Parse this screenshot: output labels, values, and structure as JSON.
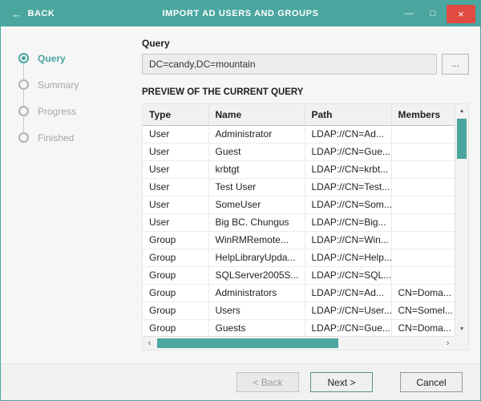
{
  "window": {
    "back_label": "BACK",
    "title": "IMPORT AD USERS AND GROUPS"
  },
  "icons": {
    "back_arrow": "←",
    "minimize": "—",
    "maximize": "□",
    "close": "×",
    "scroll_up": "▲",
    "scroll_down": "▼",
    "scroll_left": "‹",
    "scroll_right": "›"
  },
  "colors": {
    "accent": "#4aa69f",
    "close_red": "#e14a42"
  },
  "steps": [
    {
      "label": "Query",
      "active": true
    },
    {
      "label": "Summary",
      "active": false
    },
    {
      "label": "Progress",
      "active": false
    },
    {
      "label": "Finished",
      "active": false
    }
  ],
  "query": {
    "label": "Query",
    "value": "DC=candy,DC=mountain",
    "browse_label": "..."
  },
  "preview": {
    "title": "PREVIEW OF THE CURRENT QUERY",
    "columns": [
      "Type",
      "Name",
      "Path",
      "Members"
    ],
    "rows": [
      {
        "type": "User",
        "name": "Administrator",
        "path": "LDAP://CN=Ad...",
        "members": ""
      },
      {
        "type": "User",
        "name": "Guest",
        "path": "LDAP://CN=Gue...",
        "members": ""
      },
      {
        "type": "User",
        "name": "krbtgt",
        "path": "LDAP://CN=krbt...",
        "members": ""
      },
      {
        "type": "User",
        "name": "Test User",
        "path": "LDAP://CN=Test...",
        "members": ""
      },
      {
        "type": "User",
        "name": "SomeUser",
        "path": "LDAP://CN=Som...",
        "members": ""
      },
      {
        "type": "User",
        "name": "Big BC. Chungus",
        "path": "LDAP://CN=Big...",
        "members": ""
      },
      {
        "type": "Group",
        "name": "WinRMRemote...",
        "path": "LDAP://CN=Win...",
        "members": ""
      },
      {
        "type": "Group",
        "name": "HelpLibraryUpda...",
        "path": "LDAP://CN=Help...",
        "members": ""
      },
      {
        "type": "Group",
        "name": "SQLServer2005S...",
        "path": "LDAP://CN=SQL...",
        "members": ""
      },
      {
        "type": "Group",
        "name": "Administrators",
        "path": "LDAP://CN=Ad...",
        "members": "CN=Doma..."
      },
      {
        "type": "Group",
        "name": "Users",
        "path": "LDAP://CN=User...",
        "members": "CN=Somel..."
      },
      {
        "type": "Group",
        "name": "Guests",
        "path": "LDAP://CN=Gue...",
        "members": "CN=Doma..."
      }
    ]
  },
  "footer": {
    "back_label": "< Back",
    "next_label": "Next >",
    "cancel_label": "Cancel"
  }
}
